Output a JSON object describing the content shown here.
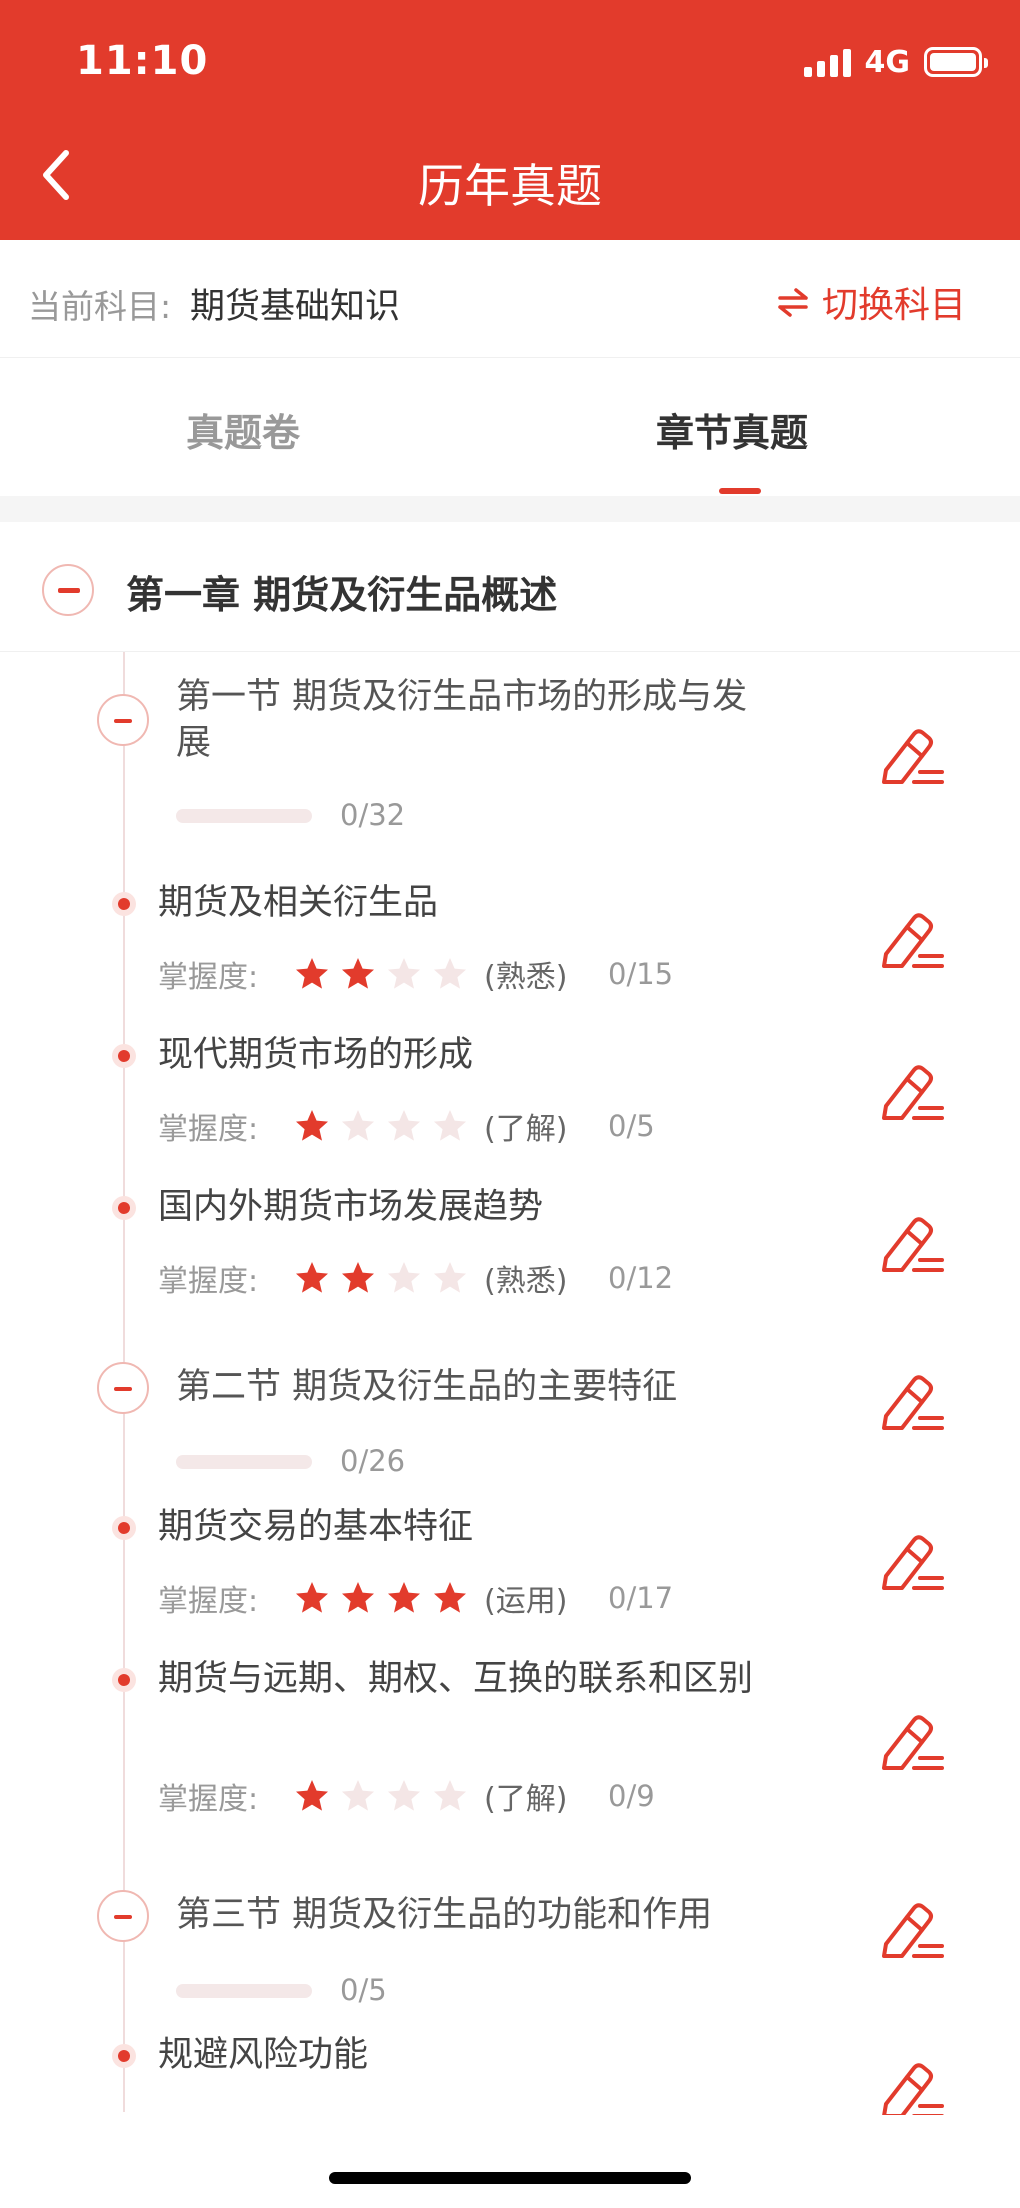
{
  "status_bar": {
    "time": "11:10",
    "network": "4G"
  },
  "header": {
    "title": "历年真题"
  },
  "subject": {
    "label": "当前科目:",
    "value": "期货基础知识",
    "switch_label": "切换科目"
  },
  "tabs": [
    {
      "label": "真题卷",
      "active": false
    },
    {
      "label": "章节真题",
      "active": true
    }
  ],
  "colors": {
    "accent": "#e23b2c",
    "star_on": "#e23b2c",
    "star_off": "#f4e6e6"
  },
  "chapter": {
    "title": "第一章 期货及衍生品概述",
    "sections": [
      {
        "title": "第一节 期货及衍生品市场的形成与发展",
        "progress": "0/32",
        "progress_fraction": 0,
        "points": [
          {
            "title": "期货及相关衍生品",
            "mastery_label": "掌握度:",
            "stars": 2,
            "level": "(熟悉)",
            "count": "0/15"
          },
          {
            "title": "现代期货市场的形成",
            "mastery_label": "掌握度:",
            "stars": 1,
            "level": "(了解)",
            "count": "0/5"
          },
          {
            "title": "国内外期货市场发展趋势",
            "mastery_label": "掌握度:",
            "stars": 2,
            "level": "(熟悉)",
            "count": "0/12"
          }
        ]
      },
      {
        "title": "第二节 期货及衍生品的主要特征",
        "progress": "0/26",
        "progress_fraction": 0,
        "points": [
          {
            "title": "期货交易的基本特征",
            "mastery_label": "掌握度:",
            "stars": 4,
            "level": "(运用)",
            "count": "0/17"
          },
          {
            "title": "期货与远期、期权、互换的联系和区别",
            "mastery_label": "掌握度:",
            "stars": 1,
            "level": "(了解)",
            "count": "0/9"
          }
        ]
      },
      {
        "title": "第三节 期货及衍生品的功能和作用",
        "progress": "0/5",
        "progress_fraction": 0,
        "points": [
          {
            "title": "规避风险功能"
          }
        ]
      }
    ]
  }
}
